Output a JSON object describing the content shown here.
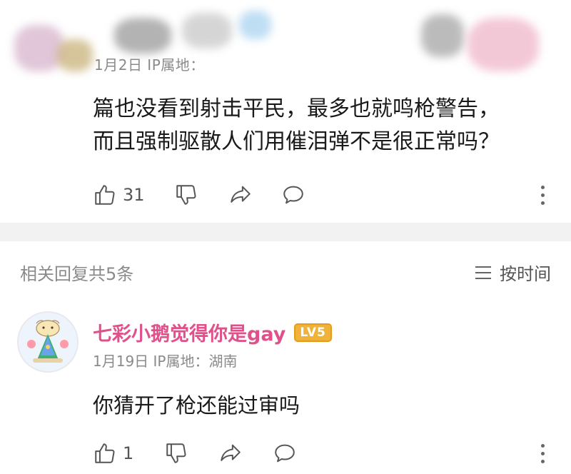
{
  "comment": {
    "meta": "1月2日  IP属地：",
    "text_line1": "篇也没看到射击平民，最多也就鸣枪警告，",
    "text_line2": "而且强制驱散人们用催泪弹不是很正常吗？",
    "like_count": "31"
  },
  "replies_header": {
    "count_label": "相关回复共5条",
    "sort_label": "按时间"
  },
  "reply": {
    "username": "七彩小鹅觉得你是gay",
    "level_badge": "LV5",
    "meta": "1月19日  IP属地：湖南",
    "text": "你猜开了枪还能过审吗",
    "like_count": "1"
  },
  "icons": {
    "like": "thumbs-up-icon",
    "dislike": "thumbs-down-icon",
    "share": "share-icon",
    "reply": "speech-bubble-icon",
    "more": "more-vertical-icon"
  },
  "colors": {
    "username": "#e0508a",
    "badge": "#f0b33a",
    "muted_text": "#8a8a8a",
    "divider": "#f2f2f2"
  }
}
